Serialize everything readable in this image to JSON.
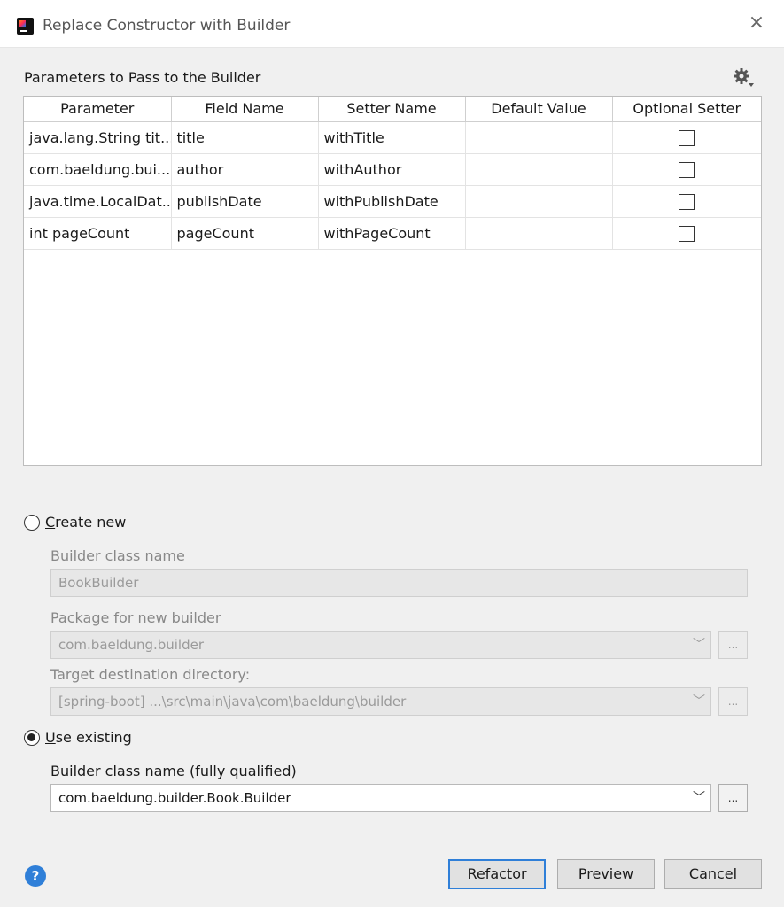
{
  "window": {
    "title": "Replace Constructor with Builder",
    "close_glyph": "×"
  },
  "params_section": {
    "title": "Parameters to Pass to the Builder"
  },
  "table": {
    "columns": [
      "Parameter",
      "Field Name",
      "Setter Name",
      "Default Value",
      "Optional Setter"
    ],
    "rows": [
      {
        "parameter": "java.lang.String tit...",
        "field": "title",
        "setter": "withTitle",
        "default": "",
        "optional": false
      },
      {
        "parameter": "com.baeldung.bui...",
        "field": "author",
        "setter": "withAuthor",
        "default": "",
        "optional": false
      },
      {
        "parameter": "java.time.LocalDat...",
        "field": "publishDate",
        "setter": "withPublishDate",
        "default": "",
        "optional": false
      },
      {
        "parameter": "int pageCount",
        "field": "pageCount",
        "setter": "withPageCount",
        "default": "",
        "optional": false
      }
    ]
  },
  "create_new": {
    "label_mnemonic": "C",
    "label_rest": "reate new",
    "selected": false,
    "builder_class_label": "Builder class name",
    "builder_class_value": "BookBuilder",
    "package_label": "Package for new builder",
    "package_value": "com.baeldung.builder",
    "target_dir_label": "Target destination directory:",
    "target_dir_value": "[spring-boot] ...\\src\\main\\java\\com\\baeldung\\builder"
  },
  "use_existing": {
    "label_mnemonic": "U",
    "label_rest": "se existing",
    "selected": true,
    "builder_class_label": "Builder class name (fully qualified)",
    "builder_class_value": "com.baeldung.builder.Book.Builder"
  },
  "glyphs": {
    "dropdown": "﹀",
    "browse": "...",
    "help": "?"
  },
  "buttons": {
    "refactor": "Refactor",
    "preview": "Preview",
    "cancel": "Cancel"
  },
  "icons": {
    "settings": "gear-icon",
    "help": "help-icon",
    "app": "intellij-icon"
  },
  "colors": {
    "accent": "#2f7fd8",
    "disabled_field": "#e7e7e7"
  }
}
